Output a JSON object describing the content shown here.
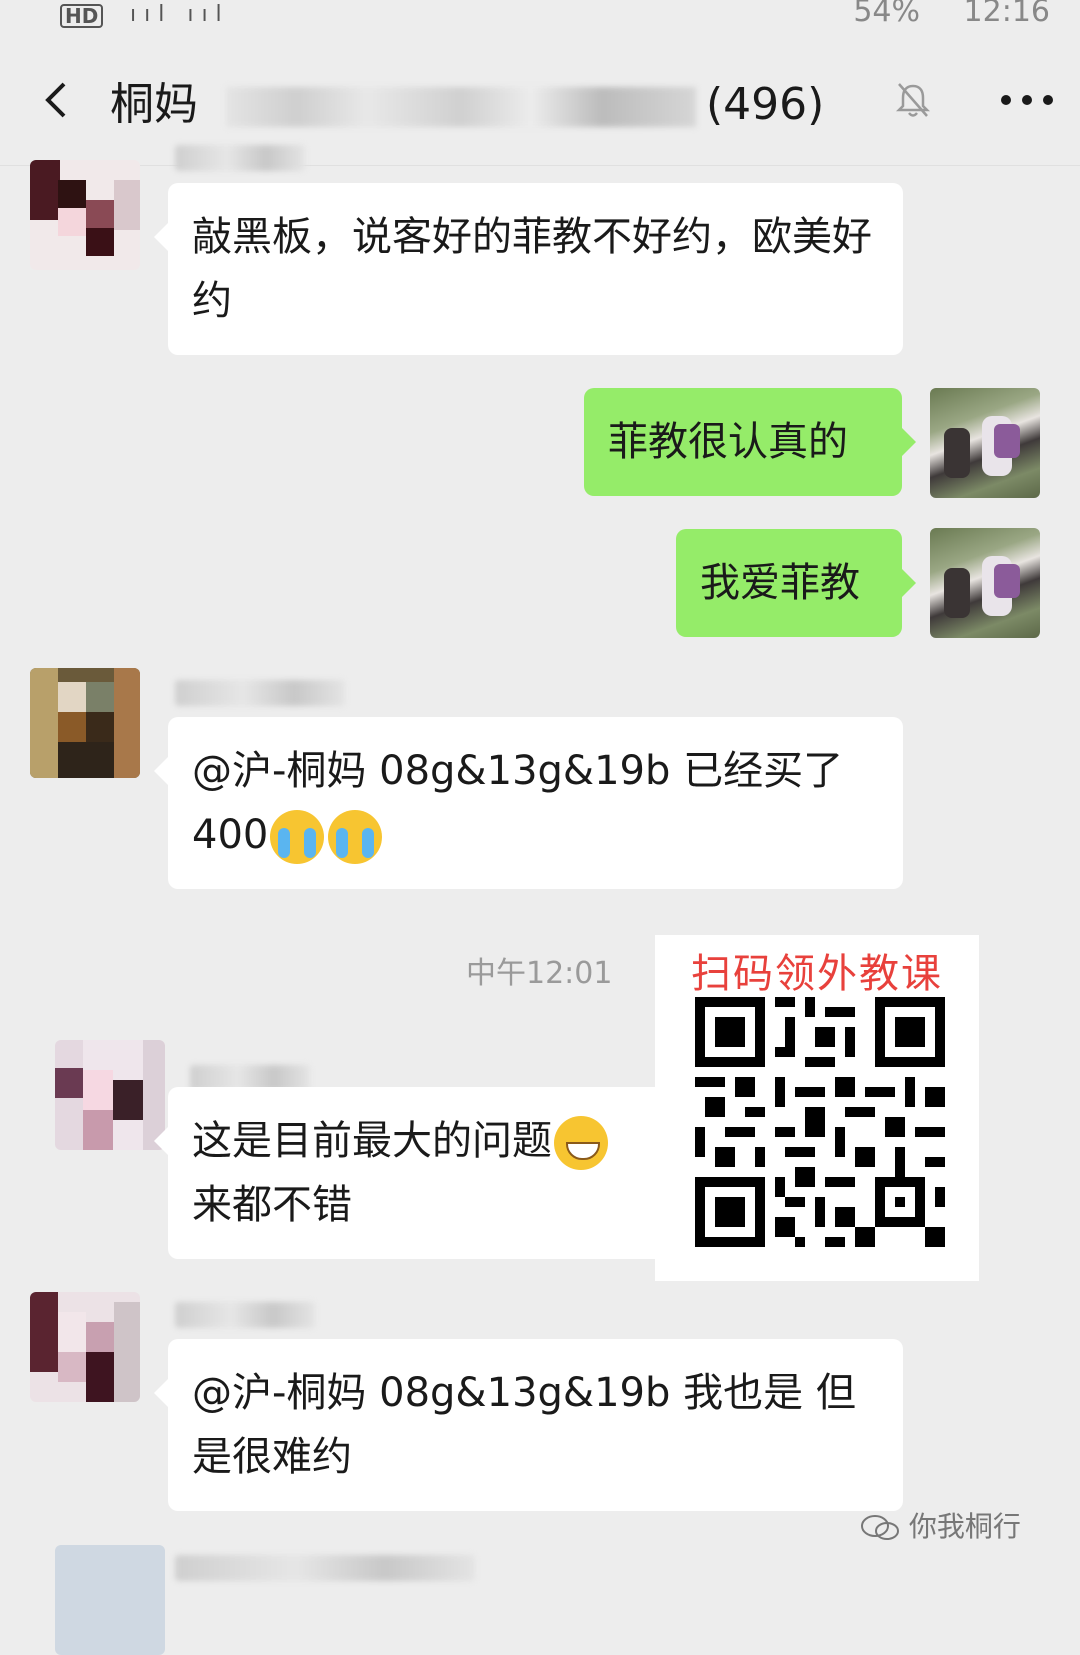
{
  "status_bar": {
    "hd": "HD",
    "signal": "ııl ııl",
    "battery": "54%",
    "time": "12:16"
  },
  "header": {
    "title_prefix": "桐妈",
    "member_count": "(496)",
    "back_icon": "back-chevron-icon",
    "mute_icon": "bell-muted-icon",
    "more_icon": "more-dots-icon"
  },
  "messages": [
    {
      "side": "left",
      "text": "敲黑板，说客好的菲教不好约，欧美好约"
    },
    {
      "side": "right",
      "text": "菲教很认真的"
    },
    {
      "side": "right",
      "text": "我爱菲教"
    },
    {
      "side": "left",
      "text": "@沪-桐妈 08g&13g&19b  已经买了400"
    },
    {
      "side": "left",
      "text": "这是目前最大的问题",
      "text_line2": "来都不错"
    },
    {
      "side": "left",
      "text": "@沪-桐妈 08g&13g&19b  我也是 但是很难约"
    }
  ],
  "timestamp": "中午12:01",
  "qr_overlay": {
    "title": "扫码领外教课"
  },
  "watermark": {
    "text": "你我桐行",
    "icon": "wechat-official-account-icon"
  },
  "colors": {
    "background": "#ededed",
    "my_bubble": "#95ec69",
    "their_bubble": "#ffffff",
    "qr_title": "#e8413c"
  }
}
